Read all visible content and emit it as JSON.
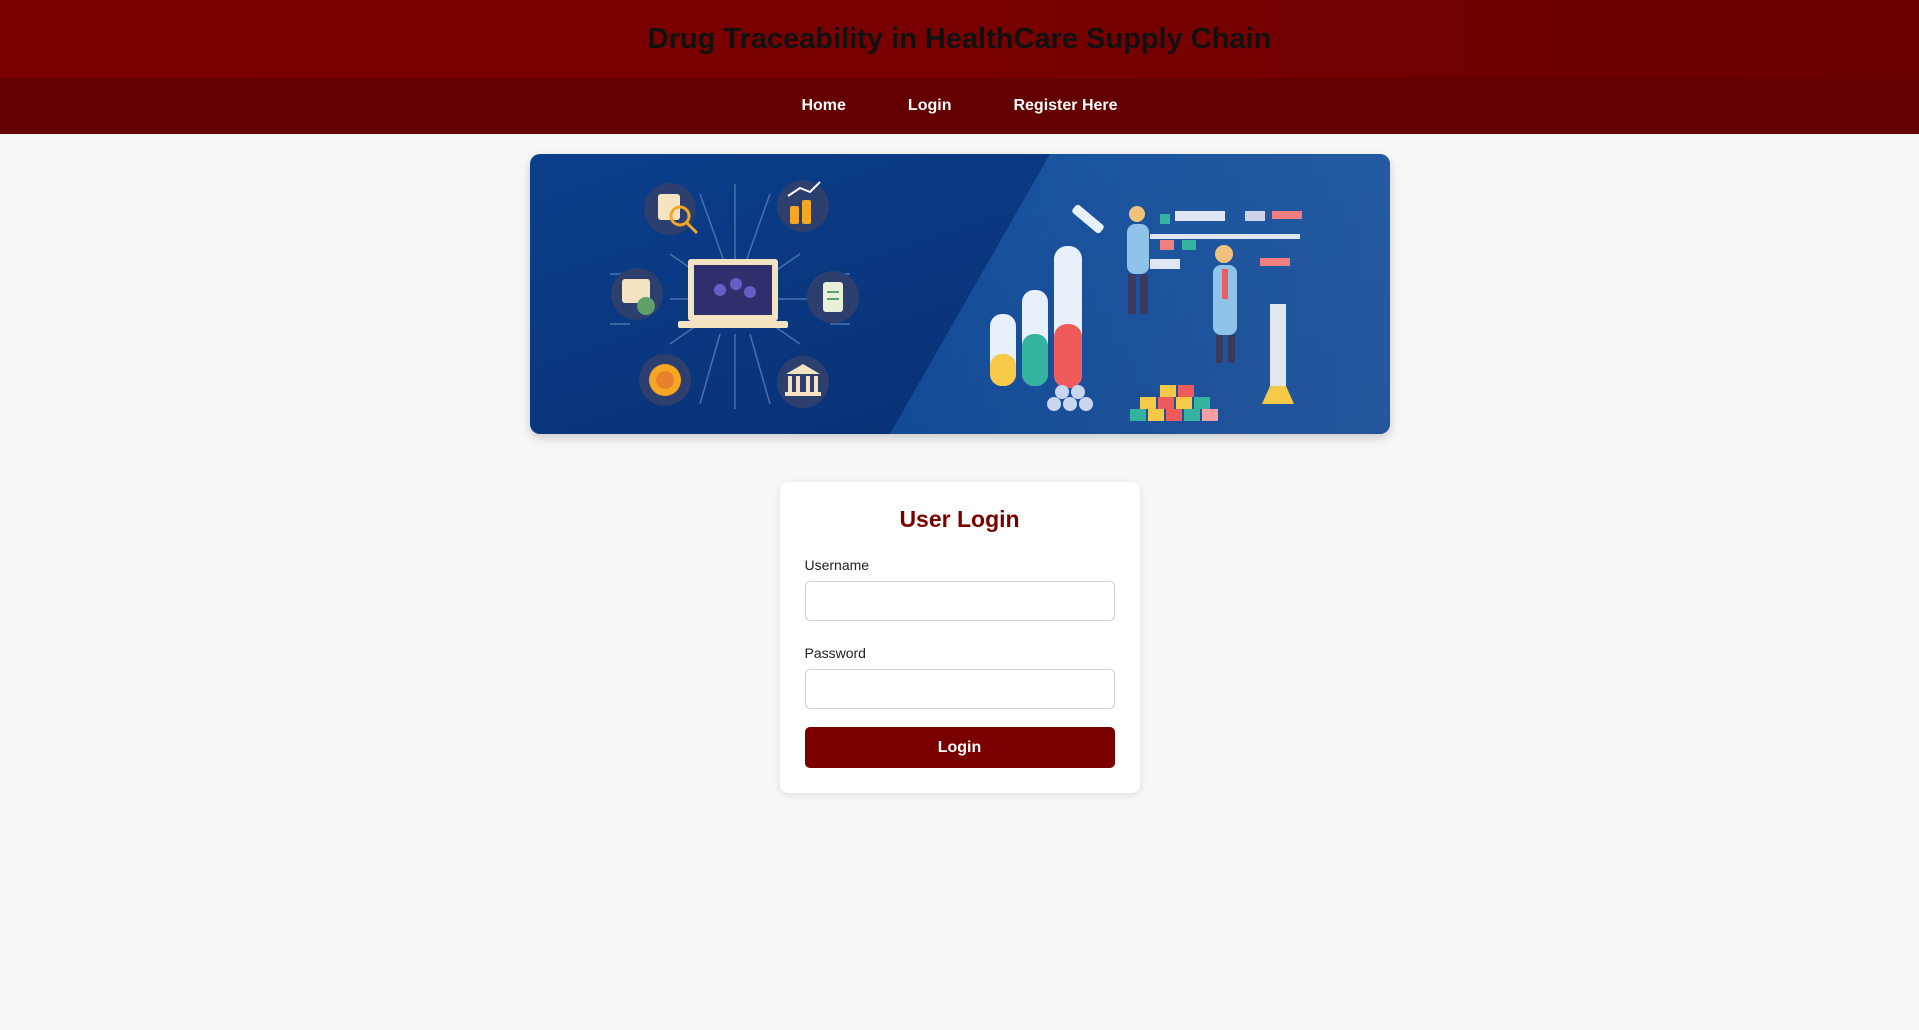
{
  "header": {
    "title": "Drug Traceability in HealthCare Supply Chain"
  },
  "nav": {
    "items": [
      "Home",
      "Login",
      "Register Here"
    ]
  },
  "banner": {
    "alt": "supply-chain-and-laboratory-illustration"
  },
  "login_form": {
    "title": "User Login",
    "username_label": "Username",
    "username_value": "",
    "password_label": "Password",
    "password_value": "",
    "submit_label": "Login"
  },
  "colors": {
    "header_bg": "#7a0000",
    "nav_bg": "#650000",
    "accent": "#7a0000",
    "page_bg": "#f7f7f7"
  }
}
